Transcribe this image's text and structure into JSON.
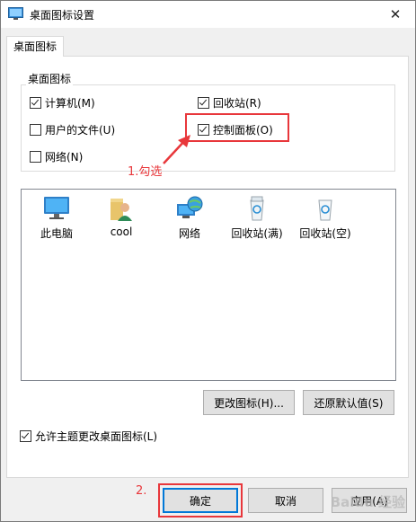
{
  "window": {
    "title": "桌面图标设置",
    "close_glyph": "✕"
  },
  "tab": {
    "label": "桌面图标"
  },
  "group": {
    "label": "桌面图标",
    "checkboxes": [
      {
        "label": "计算机(M)",
        "checked": true
      },
      {
        "label": "回收站(R)",
        "checked": true
      },
      {
        "label": "用户的文件(U)",
        "checked": false
      },
      {
        "label": "控制面板(O)",
        "checked": true
      },
      {
        "label": "网络(N)",
        "checked": false
      }
    ]
  },
  "icons": [
    {
      "label": "此电脑",
      "icon": "computer-icon"
    },
    {
      "label": "cool",
      "icon": "user-folder-icon"
    },
    {
      "label": "网络",
      "icon": "network-globe-icon"
    },
    {
      "label": "回收站(满)",
      "icon": "recycle-bin-full-icon"
    },
    {
      "label": "回收站(空)",
      "icon": "recycle-bin-empty-icon"
    }
  ],
  "buttons": {
    "change_icon": "更改图标(H)...",
    "restore_default": "还原默认值(S)",
    "ok": "确定",
    "cancel": "取消",
    "apply": "应用(A)"
  },
  "allow_themes": {
    "label": "允许主题更改桌面图标(L)",
    "checked": true
  },
  "annotations": {
    "step1": "1.勾选",
    "step2": "2."
  },
  "colors": {
    "annotation": "#e8373b",
    "accent": "#0078d7"
  },
  "watermark": "Baidu 经验"
}
